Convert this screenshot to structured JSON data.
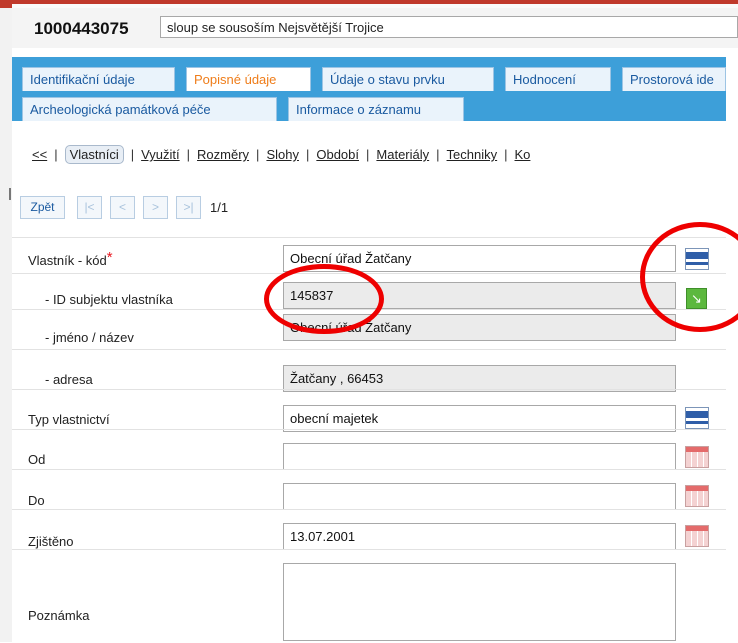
{
  "record": {
    "id": "1000443075",
    "name": "sloup se sousoším Nejsvětější Trojice"
  },
  "tabs_row1": [
    {
      "label": "Identifikační údaje",
      "active": false
    },
    {
      "label": "Popisné údaje",
      "active": true
    },
    {
      "label": "Údaje o stavu prvku",
      "active": false
    },
    {
      "label": "Hodnocení",
      "active": false
    },
    {
      "label": "Prostorová ide",
      "active": false
    }
  ],
  "tabs_row2": [
    {
      "label": "Archeologická památková péče"
    },
    {
      "label": "Informace o záznamu"
    }
  ],
  "subnav": {
    "back": "<<",
    "current": "Vlastníci",
    "items": [
      "Využití",
      "Rozměry",
      "Slohy",
      "Období",
      "Materiály",
      "Techniky",
      "Ko"
    ]
  },
  "pager": {
    "back_label": "Zpět",
    "first": "|<",
    "prev": "<",
    "next": ">",
    "last": ">|",
    "count": "1/1"
  },
  "form": {
    "owner_code_label": "Vlastník - kód",
    "owner_code_value": "Obecní úřad Žatčany",
    "owner_id_label": "- ID subjektu vlastníka",
    "owner_id_value": "145837",
    "owner_name_label": "- jméno / název",
    "owner_name_value": "Obecní úřad Žatčany",
    "owner_address_label": "- adresa",
    "owner_address_value": "Žatčany , 66453",
    "ownership_type_label": "Typ vlastnictví",
    "ownership_type_value": "obecní majetek",
    "from_label": "Od",
    "from_value": "",
    "to_label": "Do",
    "to_value": "",
    "found_label": "Zjištěno",
    "found_value": "13.07.2001",
    "note_label": "Poznámka",
    "note_value": ""
  },
  "colors": {
    "tab_bar": "#3d9fd9",
    "active_tab_text": "#ef7d1a",
    "annotation_circle": "#ee0000"
  },
  "icons": [
    "list-picker-icon",
    "open-detail-icon",
    "calendar-icon"
  ]
}
